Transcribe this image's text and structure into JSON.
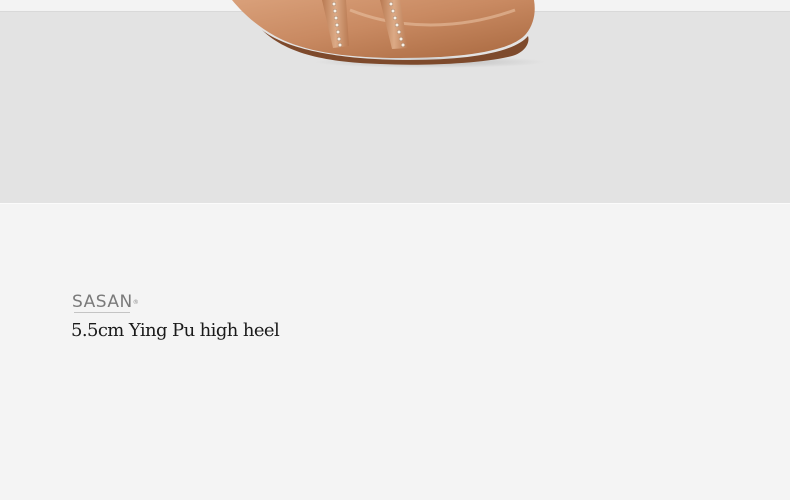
{
  "product_photo": {
    "description_icon": "dance-shoe-photo",
    "background_color": "#e3e3e3",
    "shoe_color": "#c98a62"
  },
  "caption": {
    "brand": "SASAN",
    "brand_mark": "®",
    "title": "5.5cm Ying Pu high heel"
  }
}
